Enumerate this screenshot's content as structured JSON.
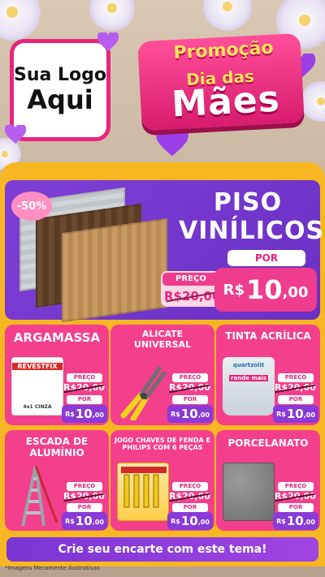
{
  "header": {
    "logo_line1": "Sua Logo",
    "logo_line2": "Aqui",
    "promo_title": "Promoção",
    "promo_subtitle": "Dia das",
    "promo_main": "Mães"
  },
  "featured": {
    "discount_badge": "-50%",
    "title_line1": "PISO",
    "title_line2": "VINÍLICOS",
    "price_label": "PREÇO",
    "old_price": "R$20,00",
    "new_label": "POR",
    "currency": "R$",
    "new_price_int": "10",
    "new_price_dec": ",00"
  },
  "products": [
    {
      "name": "ARGAMASSA",
      "price_label": "PREÇO",
      "old_price": "R$20,00",
      "new_label": "POR",
      "currency": "R$",
      "new_price_int": "10",
      "new_price_dec": ",00",
      "image_text": "REVESTFIX",
      "image_sub": "4x1 CINZA"
    },
    {
      "name": "ALICATE UNIVERSAL",
      "price_label": "PREÇO",
      "old_price": "R$20,00",
      "new_label": "POR",
      "currency": "R$",
      "new_price_int": "10",
      "new_price_dec": ",00"
    },
    {
      "name": "TINTA ACRÍLICA",
      "price_label": "PREÇO",
      "old_price": "R$20,00",
      "new_label": "POR",
      "currency": "R$",
      "new_price_int": "10",
      "new_price_dec": ",00",
      "image_text": "quartzolit",
      "image_sub": "rende mais"
    },
    {
      "name": "ESCADA DE ALUMÍNIO",
      "price_label": "PREÇO",
      "old_price": "R$20,00",
      "new_label": "POR",
      "currency": "R$",
      "new_price_int": "10",
      "new_price_dec": ",00"
    },
    {
      "name": "JOGO CHAVES DE FENDA E PHILIPS COM 6 PEÇAS",
      "price_label": "PREÇO",
      "old_price": "R$20,00",
      "new_label": "POR",
      "currency": "R$",
      "new_price_int": "10",
      "new_price_dec": ",00"
    },
    {
      "name": "PORCELANATO",
      "price_label": "PREÇO",
      "old_price": "R$20,00",
      "new_label": "POR",
      "currency": "R$",
      "new_price_int": "10",
      "new_price_dec": ",00"
    }
  ],
  "footer": {
    "cta": "Crie seu encarte com este tema!",
    "disclaimer": "*Imagens Meramente Ilustrativas"
  }
}
